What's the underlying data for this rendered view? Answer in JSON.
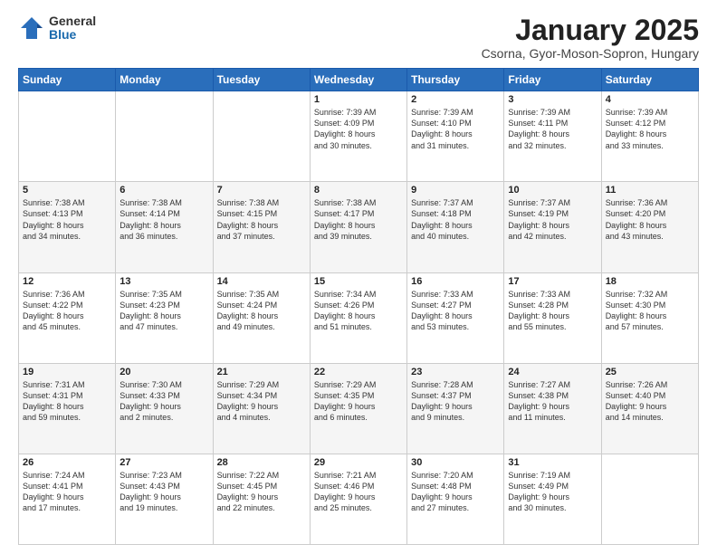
{
  "logo": {
    "general": "General",
    "blue": "Blue"
  },
  "title": "January 2025",
  "subtitle": "Csorna, Gyor-Moson-Sopron, Hungary",
  "weekdays": [
    "Sunday",
    "Monday",
    "Tuesday",
    "Wednesday",
    "Thursday",
    "Friday",
    "Saturday"
  ],
  "weeks": [
    [
      {
        "day": "",
        "info": ""
      },
      {
        "day": "",
        "info": ""
      },
      {
        "day": "",
        "info": ""
      },
      {
        "day": "1",
        "info": "Sunrise: 7:39 AM\nSunset: 4:09 PM\nDaylight: 8 hours\nand 30 minutes."
      },
      {
        "day": "2",
        "info": "Sunrise: 7:39 AM\nSunset: 4:10 PM\nDaylight: 8 hours\nand 31 minutes."
      },
      {
        "day": "3",
        "info": "Sunrise: 7:39 AM\nSunset: 4:11 PM\nDaylight: 8 hours\nand 32 minutes."
      },
      {
        "day": "4",
        "info": "Sunrise: 7:39 AM\nSunset: 4:12 PM\nDaylight: 8 hours\nand 33 minutes."
      }
    ],
    [
      {
        "day": "5",
        "info": "Sunrise: 7:38 AM\nSunset: 4:13 PM\nDaylight: 8 hours\nand 34 minutes."
      },
      {
        "day": "6",
        "info": "Sunrise: 7:38 AM\nSunset: 4:14 PM\nDaylight: 8 hours\nand 36 minutes."
      },
      {
        "day": "7",
        "info": "Sunrise: 7:38 AM\nSunset: 4:15 PM\nDaylight: 8 hours\nand 37 minutes."
      },
      {
        "day": "8",
        "info": "Sunrise: 7:38 AM\nSunset: 4:17 PM\nDaylight: 8 hours\nand 39 minutes."
      },
      {
        "day": "9",
        "info": "Sunrise: 7:37 AM\nSunset: 4:18 PM\nDaylight: 8 hours\nand 40 minutes."
      },
      {
        "day": "10",
        "info": "Sunrise: 7:37 AM\nSunset: 4:19 PM\nDaylight: 8 hours\nand 42 minutes."
      },
      {
        "day": "11",
        "info": "Sunrise: 7:36 AM\nSunset: 4:20 PM\nDaylight: 8 hours\nand 43 minutes."
      }
    ],
    [
      {
        "day": "12",
        "info": "Sunrise: 7:36 AM\nSunset: 4:22 PM\nDaylight: 8 hours\nand 45 minutes."
      },
      {
        "day": "13",
        "info": "Sunrise: 7:35 AM\nSunset: 4:23 PM\nDaylight: 8 hours\nand 47 minutes."
      },
      {
        "day": "14",
        "info": "Sunrise: 7:35 AM\nSunset: 4:24 PM\nDaylight: 8 hours\nand 49 minutes."
      },
      {
        "day": "15",
        "info": "Sunrise: 7:34 AM\nSunset: 4:26 PM\nDaylight: 8 hours\nand 51 minutes."
      },
      {
        "day": "16",
        "info": "Sunrise: 7:33 AM\nSunset: 4:27 PM\nDaylight: 8 hours\nand 53 minutes."
      },
      {
        "day": "17",
        "info": "Sunrise: 7:33 AM\nSunset: 4:28 PM\nDaylight: 8 hours\nand 55 minutes."
      },
      {
        "day": "18",
        "info": "Sunrise: 7:32 AM\nSunset: 4:30 PM\nDaylight: 8 hours\nand 57 minutes."
      }
    ],
    [
      {
        "day": "19",
        "info": "Sunrise: 7:31 AM\nSunset: 4:31 PM\nDaylight: 8 hours\nand 59 minutes."
      },
      {
        "day": "20",
        "info": "Sunrise: 7:30 AM\nSunset: 4:33 PM\nDaylight: 9 hours\nand 2 minutes."
      },
      {
        "day": "21",
        "info": "Sunrise: 7:29 AM\nSunset: 4:34 PM\nDaylight: 9 hours\nand 4 minutes."
      },
      {
        "day": "22",
        "info": "Sunrise: 7:29 AM\nSunset: 4:35 PM\nDaylight: 9 hours\nand 6 minutes."
      },
      {
        "day": "23",
        "info": "Sunrise: 7:28 AM\nSunset: 4:37 PM\nDaylight: 9 hours\nand 9 minutes."
      },
      {
        "day": "24",
        "info": "Sunrise: 7:27 AM\nSunset: 4:38 PM\nDaylight: 9 hours\nand 11 minutes."
      },
      {
        "day": "25",
        "info": "Sunrise: 7:26 AM\nSunset: 4:40 PM\nDaylight: 9 hours\nand 14 minutes."
      }
    ],
    [
      {
        "day": "26",
        "info": "Sunrise: 7:24 AM\nSunset: 4:41 PM\nDaylight: 9 hours\nand 17 minutes."
      },
      {
        "day": "27",
        "info": "Sunrise: 7:23 AM\nSunset: 4:43 PM\nDaylight: 9 hours\nand 19 minutes."
      },
      {
        "day": "28",
        "info": "Sunrise: 7:22 AM\nSunset: 4:45 PM\nDaylight: 9 hours\nand 22 minutes."
      },
      {
        "day": "29",
        "info": "Sunrise: 7:21 AM\nSunset: 4:46 PM\nDaylight: 9 hours\nand 25 minutes."
      },
      {
        "day": "30",
        "info": "Sunrise: 7:20 AM\nSunset: 4:48 PM\nDaylight: 9 hours\nand 27 minutes."
      },
      {
        "day": "31",
        "info": "Sunrise: 7:19 AM\nSunset: 4:49 PM\nDaylight: 9 hours\nand 30 minutes."
      },
      {
        "day": "",
        "info": ""
      }
    ]
  ]
}
